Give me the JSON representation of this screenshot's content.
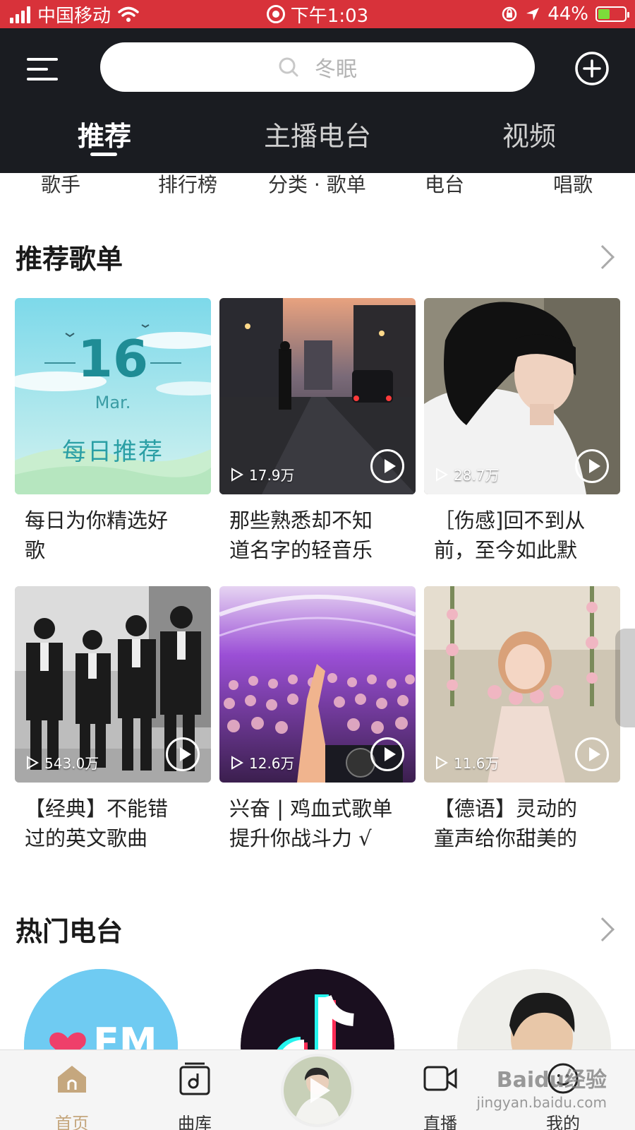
{
  "status_bar": {
    "carrier": "中国移动",
    "time": "下午1:03",
    "battery_pct": "44%",
    "battery_level": 0.44
  },
  "header": {
    "search_placeholder": "冬眠",
    "tabs": [
      {
        "label": "推荐",
        "active": true
      },
      {
        "label": "主播电台",
        "active": false
      },
      {
        "label": "视频",
        "active": false
      }
    ]
  },
  "categories": [
    "歌手",
    "排行榜",
    "分类 · 歌单",
    "电台",
    "唱歌"
  ],
  "recommend": {
    "title": "推荐歌单",
    "daily": {
      "day": "16",
      "month": "Mar.",
      "label": "每日推荐"
    },
    "playlists": [
      {
        "title_1": "每日为你精选好",
        "title_2": "歌",
        "plays": ""
      },
      {
        "title_1": "那些熟悉却不知",
        "title_2": "道名字的轻音乐",
        "plays": "17.9万"
      },
      {
        "title_1": "［伤感]回不到从",
        "title_2": "前，至今如此默",
        "plays": "28.7万"
      },
      {
        "title_1": "【经典】不能错",
        "title_2": "过的英文歌曲",
        "plays": "543.0万"
      },
      {
        "title_1": "兴奋 | 鸡血式歌单",
        "title_2": "提升你战斗力 √",
        "plays": "12.6万"
      },
      {
        "title_1": "【德语】灵动的",
        "title_2": "童声给你甜美的",
        "plays": "11.6万"
      }
    ]
  },
  "radio": {
    "title": "热门电台",
    "fm_logo": "FM"
  },
  "tabbar": {
    "items": [
      "首页",
      "曲库",
      "直播",
      "我的"
    ]
  },
  "watermark": {
    "line1": "Baidu经验",
    "line2": "jingyan.baidu.com"
  },
  "colors": {
    "status_red": "#d8323a",
    "header_dark": "#1a1c21",
    "accent_gold": "#c5a77e"
  }
}
